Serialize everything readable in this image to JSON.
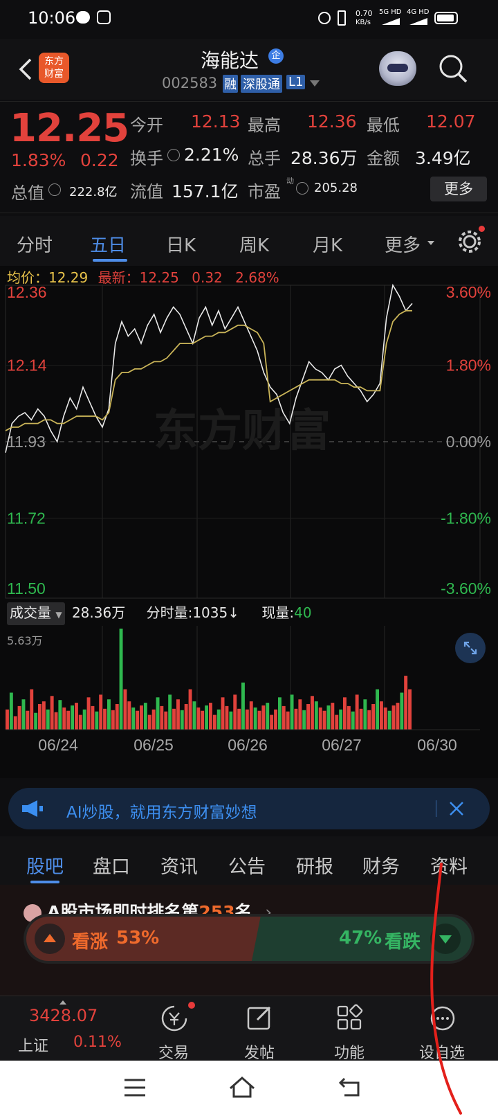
{
  "status": {
    "time": "10:06",
    "net_speed": "0.70",
    "net_unit": "KB/s",
    "sim1": "5G HD",
    "sim2": "4G HD"
  },
  "header": {
    "title": "海能达",
    "badge": "企",
    "code": "002583",
    "tag1": "融",
    "tag2": "深股通",
    "tag3": "L1",
    "logo_line1": "东方",
    "logo_line2": "财富"
  },
  "quote": {
    "price": "12.25",
    "pct": "1.83%",
    "change": "0.22",
    "open_label": "今开",
    "open": "12.13",
    "high_label": "最高",
    "high": "12.36",
    "low_label": "最低",
    "low": "12.07",
    "turnover_label": "换手",
    "turnover": "2.21%",
    "volume_label": "总手",
    "volume": "28.36万",
    "amount_label": "金额",
    "amount": "3.49亿",
    "mktcap_label": "总值",
    "mktcap": "222.8亿",
    "float_label": "流值",
    "float": "157.1亿",
    "pe_label": "市盈",
    "pe_sup": "动",
    "pe": "205.28",
    "more": "更多"
  },
  "tabs": [
    "分时",
    "五日",
    "日K",
    "周K",
    "月K",
    "更多"
  ],
  "active_tab": 1,
  "chart_info": {
    "avg_label": "均价：",
    "avg": "12.29",
    "latest_label": "最新：",
    "latest": "12.25",
    "chg": "0.32",
    "pct": "2.68%"
  },
  "chart_data": {
    "type": "line",
    "y_left": [
      "12.36",
      "12.14",
      "11.93",
      "11.72",
      "11.50"
    ],
    "y_right": [
      "3.60%",
      "1.80%",
      "0.00%",
      "-1.80%",
      "-3.60%"
    ],
    "x": [
      "06/24",
      "06/25",
      "06/26",
      "06/27",
      "06/30"
    ],
    "ylim": [
      11.5,
      12.36
    ],
    "prev_close": 11.93,
    "watermark": "东方财富",
    "series": [
      {
        "values": [
          11.9,
          11.98,
          12.0,
          12.01,
          11.99,
          12.02,
          12.0,
          11.96,
          11.93,
          12.0,
          12.05,
          12.02,
          12.08,
          12.04,
          12.0,
          11.97,
          12.02,
          12.2,
          12.26,
          12.22,
          12.24,
          12.2,
          12.25,
          12.28,
          12.23,
          12.27,
          12.3,
          12.28,
          12.24,
          12.2,
          12.27,
          12.3,
          12.25,
          12.29,
          12.24,
          12.27,
          12.3,
          12.26,
          12.22,
          12.18,
          12.12,
          12.08,
          12.06,
          12.01,
          11.98,
          12.05,
          12.1,
          12.15,
          12.13,
          12.12,
          12.1,
          12.13,
          12.14,
          12.11,
          12.09,
          12.07,
          12.04,
          12.06,
          12.09,
          12.27,
          12.36,
          12.33,
          12.29,
          12.31
        ]
      },
      {
        "values": [
          11.96,
          11.97,
          11.97,
          11.98,
          11.98,
          11.98,
          11.99,
          11.99,
          11.98,
          11.98,
          11.99,
          12.0,
          12.0,
          12.0,
          12.0,
          11.99,
          12.01,
          12.1,
          12.12,
          12.12,
          12.13,
          12.13,
          12.14,
          12.15,
          12.15,
          12.16,
          12.18,
          12.2,
          12.2,
          12.2,
          12.21,
          12.22,
          12.22,
          12.23,
          12.23,
          12.24,
          12.25,
          12.25,
          12.24,
          12.23,
          12.2,
          12.04,
          12.05,
          12.06,
          12.07,
          12.08,
          12.09,
          12.1,
          12.1,
          12.1,
          12.1,
          12.1,
          12.09,
          12.09,
          12.08,
          12.08,
          12.07,
          12.07,
          12.07,
          12.2,
          12.26,
          12.28,
          12.29,
          12.29
        ]
      }
    ],
    "series_colors": [
      "#e9e9e9",
      "#c9b458"
    ],
    "volume_max": "5.63万",
    "volume": [
      30,
      55,
      20,
      35,
      45,
      28,
      60,
      25,
      38,
      42,
      30,
      50,
      26,
      44,
      33,
      28,
      36,
      40,
      22,
      30,
      48,
      35,
      27,
      52,
      31,
      45,
      29,
      38,
      150,
      60,
      42,
      33,
      28,
      36,
      40,
      22,
      30,
      48,
      35,
      27,
      52,
      31,
      45,
      29,
      38,
      60,
      42,
      33,
      28,
      36,
      40,
      22,
      30,
      48,
      35,
      27,
      52,
      31,
      70,
      30,
      42,
      33,
      28,
      36,
      40,
      22,
      30,
      48,
      35,
      27,
      52,
      31,
      45,
      29,
      38,
      50,
      42,
      33,
      28,
      36,
      40,
      22,
      30,
      48,
      35,
      27,
      52,
      31,
      45,
      29,
      38,
      60,
      42,
      33,
      28,
      36,
      40,
      55,
      80,
      60
    ]
  },
  "vol_bar": {
    "label": "成交量",
    "total": "28.36万",
    "fs_label": "分时量:",
    "fs": "1035",
    "arrow": "↓",
    "now_label": "现量:",
    "now": "40"
  },
  "ai": {
    "text": "AI炒股，就用东方财富妙想"
  },
  "lower_tabs": [
    "股吧",
    "盘口",
    "资讯",
    "公告",
    "研报",
    "财务",
    "资料"
  ],
  "rank": {
    "prefix": "A股市场即时排名第",
    "num": "253",
    "suffix": "名",
    "up_label": "看涨",
    "up_pct": "53%",
    "down_pct": "47%",
    "down_label": "看跌"
  },
  "bottom": {
    "index_value": "3428.07",
    "index_name": "上证",
    "index_pct": "0.11%",
    "trade": "交易",
    "post": "发帖",
    "func": "功能",
    "fav": "设自选"
  }
}
